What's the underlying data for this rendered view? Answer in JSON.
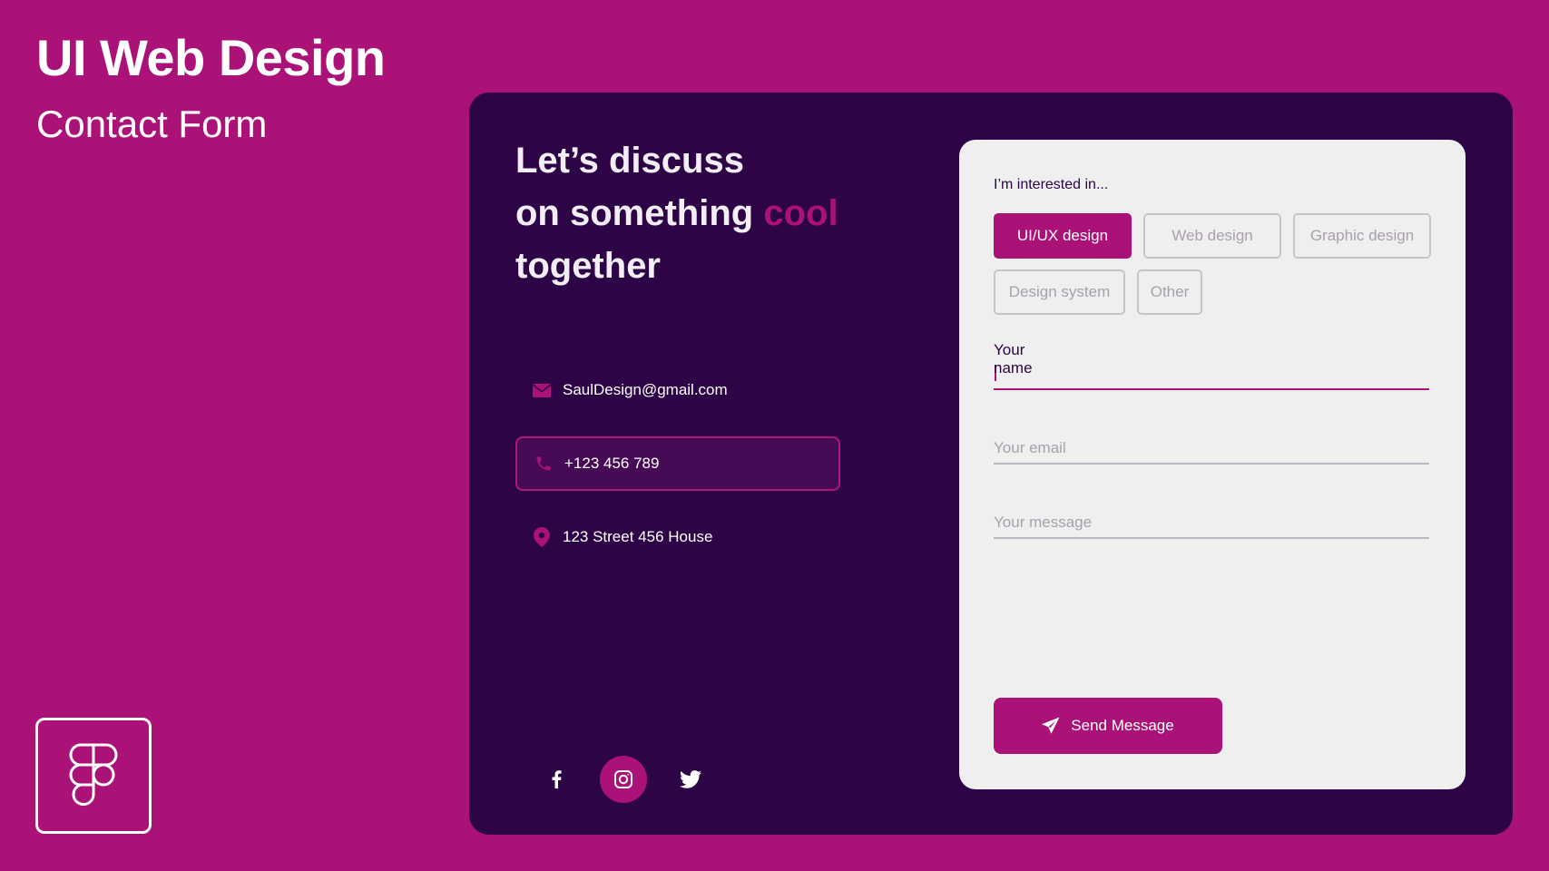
{
  "header": {
    "title": "UI Web Design",
    "subtitle": "Contact Form"
  },
  "colors": {
    "background": "#ab1278",
    "card": "#2d0446",
    "accent": "#ab1278",
    "form_panel": "#efefef"
  },
  "intro": {
    "line1": "Let’s discuss",
    "line2_prefix": "on something ",
    "line2_accent": "cool",
    "line3": "together"
  },
  "contact": {
    "email": "SaulDesign@gmail.com",
    "phone": "+123 456 789",
    "address": "123 Street 456 House"
  },
  "socials": [
    "facebook-icon",
    "instagram-icon",
    "twitter-icon"
  ],
  "form": {
    "interest_label": "I’m interested in...",
    "chips": [
      "UI/UX design",
      "Web design",
      "Graphic design",
      "Design system",
      "Other"
    ],
    "selected_chip": "UI/UX design",
    "name_placeholder": "Your name",
    "email_placeholder": "Your email",
    "message_placeholder": "Your message",
    "submit_label": "Send Message"
  }
}
